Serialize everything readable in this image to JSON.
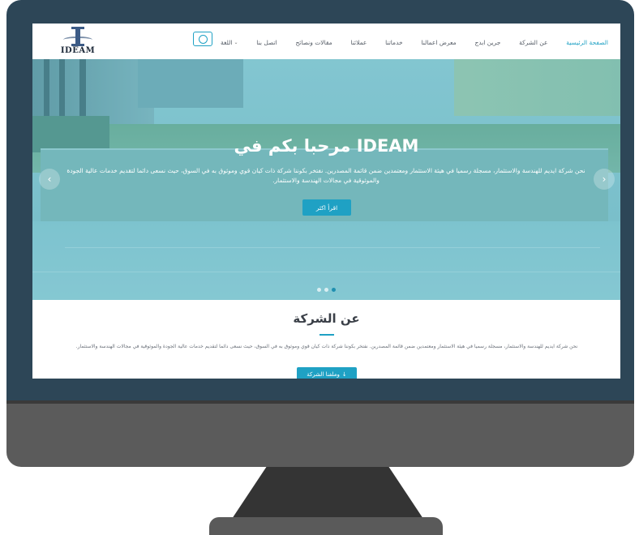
{
  "brand": {
    "logo_text": "IDEAM"
  },
  "nav": {
    "items": [
      {
        "label": "الصفحة الرئيسية",
        "active": true
      },
      {
        "label": "عن الشركة",
        "active": false
      },
      {
        "label": "جرين ابدج",
        "active": false
      },
      {
        "label": "معرض اعمالنا",
        "active": false
      },
      {
        "label": "خدماتنا",
        "active": false
      },
      {
        "label": "عملائنا",
        "active": false
      },
      {
        "label": "مقالات ونصائح",
        "active": false
      },
      {
        "label": "اتصل بنا",
        "active": false
      }
    ],
    "language_label": "اللغة",
    "whatsapp_icon": "whatsapp-icon"
  },
  "hero": {
    "title": "مرحبا بكم في IDEAM",
    "text": "نحن شركة ايديم للهندسة والاستثمار، مسجلة رسميا في هيئة الاستثمار ومعتمدين ضمن قائمة المصدرين. نفتخر بكوننا شركة ذات كيان قوي وموثوق به في السوق، حيث نسعى دائما لتقديم خدمات عالية الجودة والموثوقية في مجالات الهندسة والاستثمار.",
    "cta_label": "اقرأ اكثر",
    "slides_total": 3,
    "slide_active": 3
  },
  "about": {
    "title": "عن الشركة",
    "text": "نحن شركة ايديم للهندسة والاستثمار، مسجلة رسميا في هيئة الاستثمار ومعتمدين ضمن قائمة المصدرين. نفتخر بكوننا شركة ذات كيان قوي وموثوق به في السوق، حيث نسعى دائما لتقديم خدمات عالية الجودة والموثوقية في مجالات الهندسة والاستثمار.",
    "button_label": "وملفنا الشركة",
    "button_icon": "download-icon"
  },
  "colors": {
    "accent": "#1fa1c4",
    "monitor_frame": "#2d4657",
    "monitor_chin": "#5b5b5b"
  }
}
